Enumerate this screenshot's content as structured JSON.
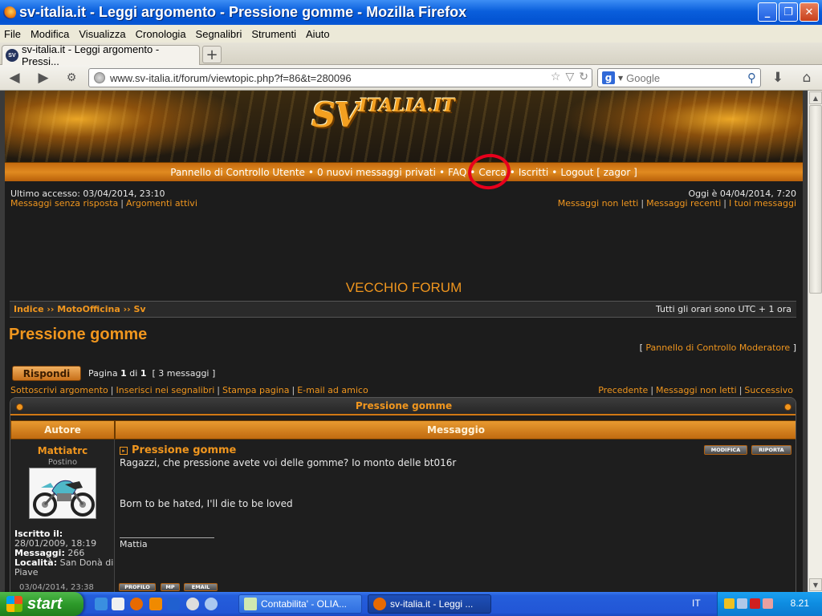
{
  "window": {
    "title": "sv-italia.it - Leggi argomento - Pressione gomme - Mozilla Firefox",
    "btn_min": "_",
    "btn_max": "❐",
    "btn_close": "✕"
  },
  "menu": [
    "File",
    "Modifica",
    "Visualizza",
    "Cronologia",
    "Segnalibri",
    "Strumenti",
    "Aiuto"
  ],
  "tab": {
    "label": "sv-italia.it - Leggi argomento - Pressi...",
    "favicon_text": "SV",
    "new_tab": "+"
  },
  "nav": {
    "url": "www.sv-italia.it/forum/viewtopic.php?f=86&t=280096",
    "search_placeholder": "Google",
    "search_engine_letter": "g",
    "back": "◀",
    "forward": "▶",
    "home": "⌂",
    "download": "⬇",
    "reload": "↻",
    "star": "☆",
    "dropdown": "▽",
    "search_caret": "▼",
    "magnifier": "⚲",
    "identity": "⚙"
  },
  "forum": {
    "logo_main": "SV",
    "logo_sub": "ITALIA",
    "logo_tld": ".IT",
    "topnav": [
      "Pannello di Controllo Utente",
      "0 nuovi messaggi privati",
      "FAQ",
      "Cerca",
      "Iscritti",
      "Logout [ zagor ]"
    ],
    "topnav_sep": "•",
    "last_visit": "Ultimo accesso: 03/04/2014, 23:10",
    "today": "Oggi è 04/04/2014, 7:20",
    "links_left": [
      "Messaggi senza risposta",
      "Argomenti attivi"
    ],
    "links_right": [
      "Messaggi non letti",
      "Messaggi recenti",
      "I tuoi messaggi"
    ],
    "pipe": "|",
    "old_forum": "VECCHIO FORUM",
    "breadcrumb": "Indice ›› MotoOfficina ›› Sv",
    "timezone": "Tutti gli orari sono UTC + 1 ora",
    "topic_title": "Pressione gomme",
    "mod_panel_open": "[",
    "mod_panel": "Pannello di Controllo Moderatore",
    "mod_panel_close": "]",
    "reply_button": "Rispondi",
    "pagination_prefix": "Pagina",
    "pagination_current": "1",
    "pagination_of": "di",
    "pagination_total": "1",
    "message_count": "[ 3 messaggi ]",
    "actions_left": [
      "Sottoscrivi argomento",
      "Inserisci nei segnalibri",
      "Stampa pagina",
      "E-mail ad amico"
    ],
    "actions_right": [
      "Precedente",
      "Messaggi non letti",
      "Successivo"
    ],
    "table_title": "Pressione gomme",
    "col_author": "Autore",
    "col_message": "Messaggio"
  },
  "post": {
    "author": "Mattiatrc",
    "rank": "Postino",
    "joined_label": "Iscritto il:",
    "joined": "28/01/2009, 18:19",
    "messages_label": "Messaggi:",
    "messages": "266",
    "location_label": "Località:",
    "location": "San Donà di Piave",
    "title": "Pressione gomme",
    "btn_edit": "MODIFICA",
    "btn_report": "RIPORTA",
    "line1": "Ragazzi, che pressione avete voi delle gomme? Io monto delle bt016r",
    "line2": "Born to be hated, I'll die to be loved",
    "signature": "Mattia",
    "footer_date": "03/04/2014, 23:38",
    "footer_btns": [
      "PROFILO",
      "MP",
      "EMAIL"
    ]
  },
  "taskbar": {
    "start": "start",
    "windows": [
      {
        "label": "Contabilita' - OLIA..."
      },
      {
        "label": "sv-italia.it - Leggi ..."
      }
    ],
    "lang": "IT",
    "clock": "8.21"
  },
  "colors": {
    "accent_orange": "#f0961e",
    "annotation_red": "#e8001c",
    "xp_blue": "#245edb"
  }
}
